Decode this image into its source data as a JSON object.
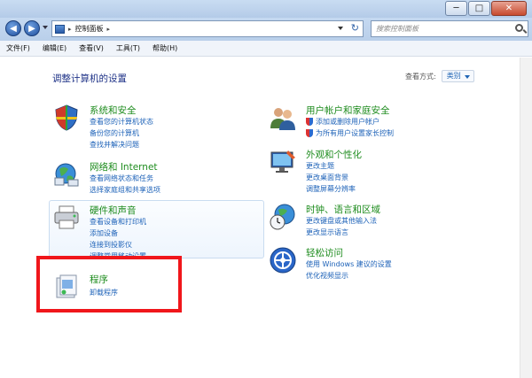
{
  "window": {
    "minimize": "─",
    "maximize": "□",
    "close": "✕"
  },
  "nav": {
    "back_icon": "back-arrow",
    "forward_icon": "forward-arrow",
    "breadcrumb": "控制面板",
    "breadcrumb_sep": "▸",
    "search_placeholder": "搜索控制面板"
  },
  "menu": [
    "文件(F)",
    "编辑(E)",
    "查看(V)",
    "工具(T)",
    "帮助(H)"
  ],
  "content": {
    "heading": "调整计算机的设置",
    "view_by_label": "查看方式:",
    "view_by_value": "类别"
  },
  "categories": {
    "system": {
      "title": "系统和安全",
      "links": [
        "查看您的计算机状态",
        "备份您的计算机",
        "查找并解决问题"
      ]
    },
    "network": {
      "title": "网络和 Internet",
      "links": [
        "查看网络状态和任务",
        "选择家庭组和共享选项"
      ]
    },
    "hardware": {
      "title": "硬件和声音",
      "links": [
        "查看设备和打印机",
        "添加设备",
        "连接到投影仪",
        "调整常用移动设置"
      ]
    },
    "programs": {
      "title": "程序",
      "links": [
        "卸载程序"
      ]
    },
    "users": {
      "title": "用户帐户和家庭安全",
      "links": [
        "添加或删除用户帐户",
        "为所有用户设置家长控制"
      ]
    },
    "appearance": {
      "title": "外观和个性化",
      "links": [
        "更改主题",
        "更改桌面背景",
        "调整屏幕分辨率"
      ]
    },
    "clock": {
      "title": "时钟、语言和区域",
      "links": [
        "更改键盘或其他输入法",
        "更改显示语言"
      ]
    },
    "access": {
      "title": "轻松访问",
      "links": [
        "使用 Windows 建议的设置",
        "优化视频显示"
      ]
    }
  },
  "colors": {
    "category_title": "#1e8c1e",
    "link": "#1d62b8",
    "heading": "#1e3287",
    "highlight": "#f0161b"
  }
}
